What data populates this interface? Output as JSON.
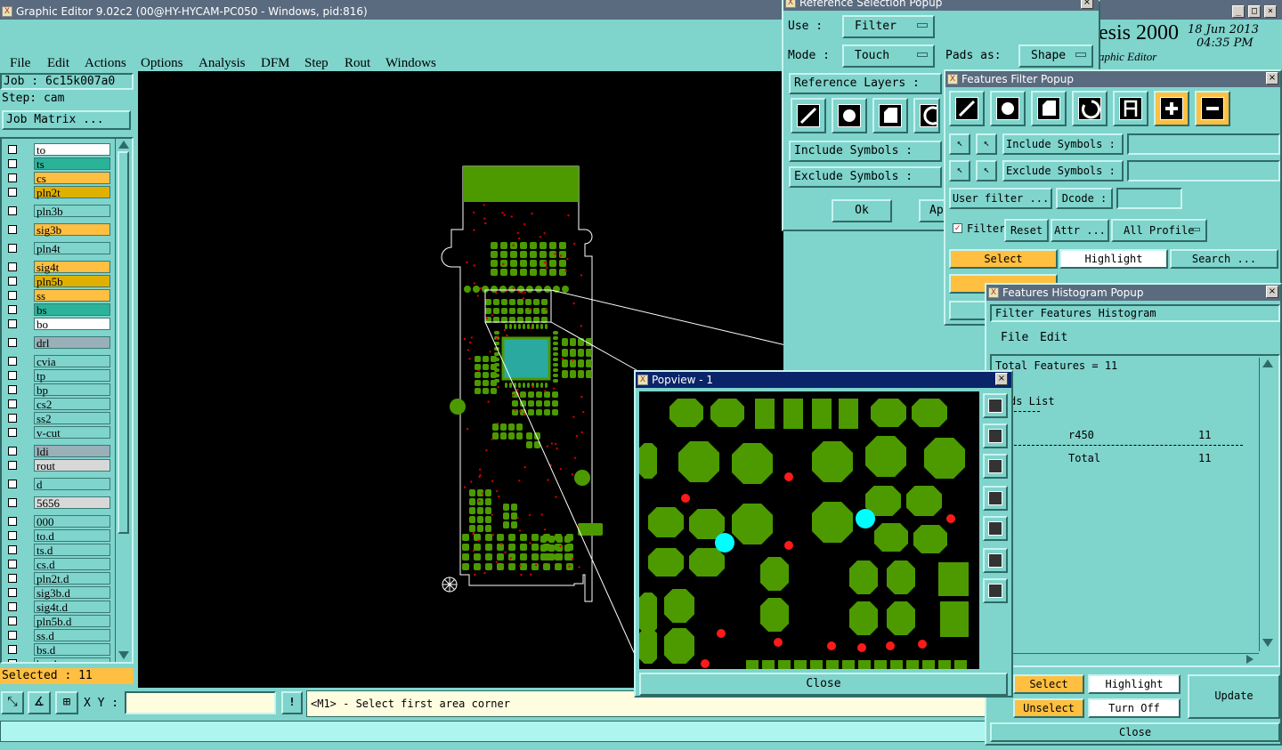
{
  "window": {
    "title": "Graphic Editor 9.02c2 (00@HY-HYCAM-PC050 - Windows, pid:816)",
    "brand": "esis 2000",
    "subbrand": "aphic Editor",
    "date": "18 Jun 2013",
    "time": "04:35 PM"
  },
  "menu": [
    "File",
    "Edit",
    "Actions",
    "Options",
    "Analysis",
    "DFM",
    "Step",
    "Rout",
    "Windows"
  ],
  "job": {
    "job_label": "Job : 6c15k007a0",
    "step_label": "Step: cam",
    "matrix_button": "Job Matrix ..."
  },
  "layers": [
    {
      "name": "to",
      "color": "#ffffff"
    },
    {
      "name": "ts",
      "color": "#2bb39a"
    },
    {
      "name": "cs",
      "color": "#ffbf40"
    },
    {
      "name": "pln2t",
      "color": "#e0b000"
    },
    {
      "name": "pln3b",
      "color": "#7fd4cc"
    },
    {
      "name": "sig3b",
      "color": "#ffbf40"
    },
    {
      "name": "pln4t",
      "color": "#7fd4cc"
    },
    {
      "name": "sig4t",
      "color": "#ffbf40"
    },
    {
      "name": "pln5b",
      "color": "#e0b000"
    },
    {
      "name": "ss",
      "color": "#ffbf40"
    },
    {
      "name": "bs",
      "color": "#2bb39a"
    },
    {
      "name": "bo",
      "color": "#ffffff"
    },
    {
      "name": "drl",
      "color": "#9ab0b8"
    },
    {
      "name": "cvia",
      "color": "#7fd4cc"
    },
    {
      "name": "tp",
      "color": "#7fd4cc"
    },
    {
      "name": "bp",
      "color": "#7fd4cc"
    },
    {
      "name": "cs2",
      "color": "#7fd4cc"
    },
    {
      "name": "ss2",
      "color": "#7fd4cc"
    },
    {
      "name": "v-cut",
      "color": "#7fd4cc"
    },
    {
      "name": "ldi",
      "color": "#9ab0b8"
    },
    {
      "name": "rout",
      "color": "#d8d8d8"
    },
    {
      "name": "d",
      "color": "#7fd4cc"
    },
    {
      "name": "5656",
      "color": "#d8d8d8"
    },
    {
      "name": "000",
      "color": "#7fd4cc"
    },
    {
      "name": "to.d",
      "color": "#7fd4cc"
    },
    {
      "name": "ts.d",
      "color": "#7fd4cc"
    },
    {
      "name": "cs.d",
      "color": "#7fd4cc"
    },
    {
      "name": "pln2t.d",
      "color": "#7fd4cc"
    },
    {
      "name": "sig3b.d",
      "color": "#7fd4cc"
    },
    {
      "name": "sig4t.d",
      "color": "#7fd4cc"
    },
    {
      "name": "pln5b.d",
      "color": "#7fd4cc"
    },
    {
      "name": "ss.d",
      "color": "#7fd4cc"
    },
    {
      "name": "bs.d",
      "color": "#7fd4cc"
    },
    {
      "name": "bo.d",
      "color": "#7fd4cc"
    }
  ],
  "status": {
    "selected": "Selected : 11",
    "xy_label": "X Y :",
    "xy_value": "",
    "prompt": "<M1> - Select first area corner"
  },
  "ref_popup": {
    "title": "Reference Selection Popup",
    "use_label": "Use :",
    "use_value": "Filter",
    "mode_label": "Mode :",
    "mode_value": "Touch",
    "pads_label": "Pads as:",
    "pads_value": "Shape",
    "ref_layers": "Reference Layers :",
    "include_symbols": "Include Symbols :",
    "exclude_symbols": "Exclude Symbols :",
    "ok": "Ok",
    "apply": "Ap"
  },
  "filter_popup": {
    "title": "Features Filter Popup",
    "include_symbols": "Include Symbols :",
    "exclude_symbols": "Exclude Symbols :",
    "user_filter": "User filter ...",
    "dcode": "Dcode :",
    "filter": "Filter",
    "reset": "Reset",
    "attr": "Attr ...",
    "all_profile": "All Profile",
    "select": "Select",
    "highlight": "Highlight",
    "search": "Search ..."
  },
  "histogram_popup": {
    "title": "Features Histogram Popup",
    "header": "Filter Features Histogram",
    "menu_file": "File",
    "menu_edit": "Edit",
    "total_features": "Total Features = 11",
    "list_title": "ds List",
    "row_symbol": "r450",
    "row_count": "11",
    "total_label": "Total",
    "total_count": "11",
    "select": "Select",
    "highlight": "Highlight",
    "update": "Update",
    "unselect": "Unselect",
    "turn_off": "Turn Off",
    "close": "Close"
  },
  "popview": {
    "title": "Popview - 1",
    "close": "Close"
  },
  "colors": {
    "pad": "#4c9a00",
    "via": "#ff1a1a",
    "highlight": "#00ffff",
    "canvas": "#000000",
    "panel": "#7fd4cc"
  }
}
